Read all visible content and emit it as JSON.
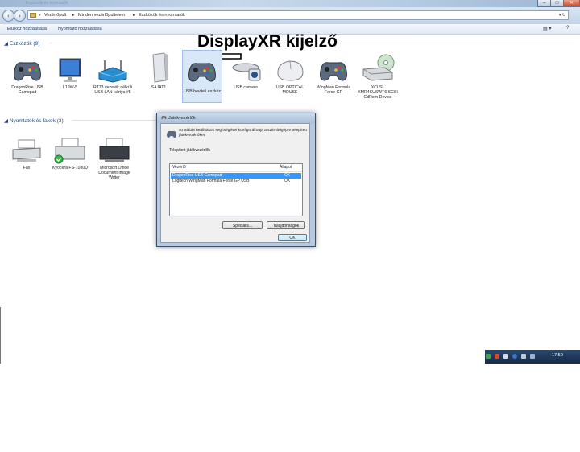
{
  "titlebar": {
    "ghost_text": "Eszközök és nyomtatók",
    "min": "–",
    "max": "□",
    "close": "✕"
  },
  "nav": {
    "back_icon": "back-arrow-icon",
    "forward_icon": "forward-arrow-icon",
    "breadcrumbs": [
      "Vezérlőpult",
      "Minden vezérlőpultelem",
      "Eszközök és nyomtatók"
    ]
  },
  "toolbar": {
    "add_device": "Eszköz hozzáadása",
    "add_printer": "Nyomtató hozzáadása"
  },
  "annotation": "DisplayXR kijelző",
  "devices_group": {
    "header": "Eszközök (9)",
    "items": [
      {
        "label": "DragonRise USB Gamepad",
        "icon": "gamepad-icon"
      },
      {
        "label": "L19W-5",
        "icon": "monitor-icon"
      },
      {
        "label": "RT73 vezeték nélküli USB LAN-kártya #5",
        "icon": "router-icon"
      },
      {
        "label": "SAJAT1",
        "icon": "computer-tower-icon"
      },
      {
        "label": "USB beviteli eszköz",
        "icon": "gamepad-icon"
      },
      {
        "label": "USB camera",
        "icon": "webcam-icon"
      },
      {
        "label": "USB OPTICAL MOUSE",
        "icon": "mouse-icon"
      },
      {
        "label": "WingMan Formula Force GP",
        "icon": "gamepad-icon"
      },
      {
        "label": "XCLSL XMR4SUSWT6 SCSI CdRom Device",
        "icon": "cdrom-drive-icon"
      }
    ]
  },
  "printers_group": {
    "header": "Nyomtatók és faxok (3)",
    "items": [
      {
        "label": "Fax",
        "icon": "fax-icon"
      },
      {
        "label": "Kyocera FS-1030D",
        "icon": "printer-icon"
      },
      {
        "label": "Microsoft Office Document Image Writer",
        "icon": "printer-icon"
      }
    ]
  },
  "dialog": {
    "title": "Játékvezérlők",
    "description": "Az alábbi beállítások segítségével konfigurálhatja a számítógépre telepített játékvezérlőket.",
    "list_label": "Telepített játékvezérlők",
    "columns": [
      "Vezérlő",
      "Állapot"
    ],
    "rows": [
      {
        "name": "DragonRise USB Gamepad",
        "status": "OK"
      },
      {
        "name": "Logitech WingMan Formula Force GP USB",
        "status": "OK"
      }
    ],
    "advanced_button": "Speciális...",
    "properties_button": "Tulajdonságok",
    "ok_button": "OK"
  },
  "taskbar": {
    "clock": "17:50"
  }
}
